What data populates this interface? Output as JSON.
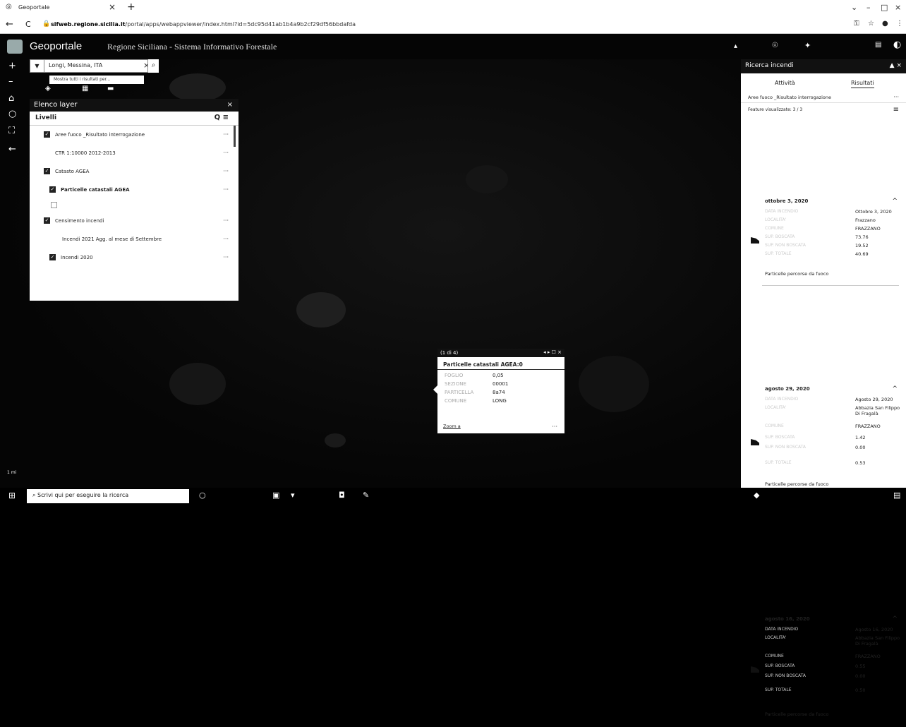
{
  "browser": {
    "tab_title": "Geoportale",
    "tab_close": "×",
    "tab_add": "+",
    "url_host": "sifweb.regione.sicilia.it",
    "url_rest": "/portal/apps/webappviewer/index.html?id=5dc95d41ab1b4a9b2cf29df56bbdafda",
    "back": "←",
    "reload": "C",
    "win_min": "–",
    "win_max": "□",
    "win_close": "×"
  },
  "app": {
    "title": "Geoportale",
    "subtitle": "Regione Siciliana - Sistema Informativo Forestale"
  },
  "search": {
    "value": "Longi, Messina, ITA",
    "clear": "×",
    "go_icon": "search-icon",
    "suggestion": "Mostra tutti i risultati per..."
  },
  "map_tools": [
    "+",
    "–",
    "⌂",
    "○",
    "⛶",
    "←"
  ],
  "layer_panel": {
    "title": "Elenco layer",
    "close": "×",
    "section": "Livelli",
    "tools": "Q ≡",
    "layers": [
      {
        "label": "Aree fuoco _Risultato interrogazione",
        "checked": true,
        "more": "···"
      },
      {
        "label": "CTR 1:10000 2012-2013",
        "checked": false,
        "more": "···"
      },
      {
        "label": "Catasto AGEA",
        "checked": true,
        "more": "···"
      },
      {
        "label": "Particelle catastali AGEA",
        "checked": true,
        "more": "···"
      },
      {
        "label": "Censimento incendi",
        "checked": true,
        "more": "···"
      },
      {
        "label": "Incendi 2021 Agg. al mese di Settembre",
        "checked": false,
        "more": "···"
      },
      {
        "label": "Incendi 2020",
        "checked": true,
        "more": "···"
      }
    ]
  },
  "popup": {
    "header": "(1 di 4)",
    "controls": "◂ ▸ ☐ ×",
    "title": "Particelle catastali AGEA:0",
    "rows": [
      {
        "k": "FOGLIO",
        "v": "0,05"
      },
      {
        "k": "SEZIONE",
        "v": "00001"
      },
      {
        "k": "PARTICELLA",
        "v": "8a74"
      },
      {
        "k": "COMUNE",
        "v": "LONG"
      }
    ],
    "footer": "Zoom a",
    "dots": "···"
  },
  "results_panel": {
    "title": "Ricerca incendi",
    "controls": "▲ ×",
    "tab_activity": "Attività",
    "tab_results": "Risultati",
    "layer_line": "Aree fuoco _Risultato interrogazione",
    "layer_more": "···",
    "features": "Feature visualizzate: 3 / 3",
    "feature_icon": "≡",
    "groups": [
      {
        "date": "ottobre 3, 2020",
        "rows": [
          {
            "k": "DATA INCENDIO",
            "v": "Ottobre 3, 2020"
          },
          {
            "k": "LOCALITA'",
            "v": "Frazzano"
          },
          {
            "k": "COMUNE",
            "v": "FRAZZANO"
          },
          {
            "k": "SUP. BOSCATA",
            "v": "73.76"
          },
          {
            "k": "SUP. NON BOSCATA",
            "v": "19.52"
          },
          {
            "k": "SUP. TOTALE",
            "v": "40.69"
          }
        ],
        "link": "Particelle percorse da fuoco"
      },
      {
        "date": "agosto 29, 2020",
        "rows": [
          {
            "k": "DATA INCENDIO",
            "v": "Agosto 29, 2020"
          },
          {
            "k": "LOCALITA'",
            "v": "Abbazia San Filippo Di Fragalà"
          },
          {
            "k": "COMUNE",
            "v": "FRAZZANO"
          },
          {
            "k": "SUP. BOSCATA",
            "v": "1.42"
          },
          {
            "k": "SUP. NON BOSCATA",
            "v": "0.00"
          },
          {
            "k": "SUP. TOTALE",
            "v": "0.53"
          }
        ],
        "link": "Particelle percorse da fuoco"
      },
      {
        "date": "agosto 16, 2020",
        "rows": [
          {
            "k": "DATA INCENDIO",
            "v": "Agosto 16, 2020"
          },
          {
            "k": "LOCALITA'",
            "v": "Abbazia San Filippo Di Fragalà"
          },
          {
            "k": "COMUNE",
            "v": "FRAZZANO"
          },
          {
            "k": "SUP. BOSCATA",
            "v": "0.55"
          },
          {
            "k": "SUP. NON BOSCATA",
            "v": "0.00"
          },
          {
            "k": "SUP. TOTALE",
            "v": "0.50"
          }
        ],
        "link": "Particelle percorse da fuoco"
      }
    ]
  },
  "scale": "1 mi",
  "taskbar": {
    "search_placeholder": "Scrivi qui per eseguire la ricerca"
  }
}
